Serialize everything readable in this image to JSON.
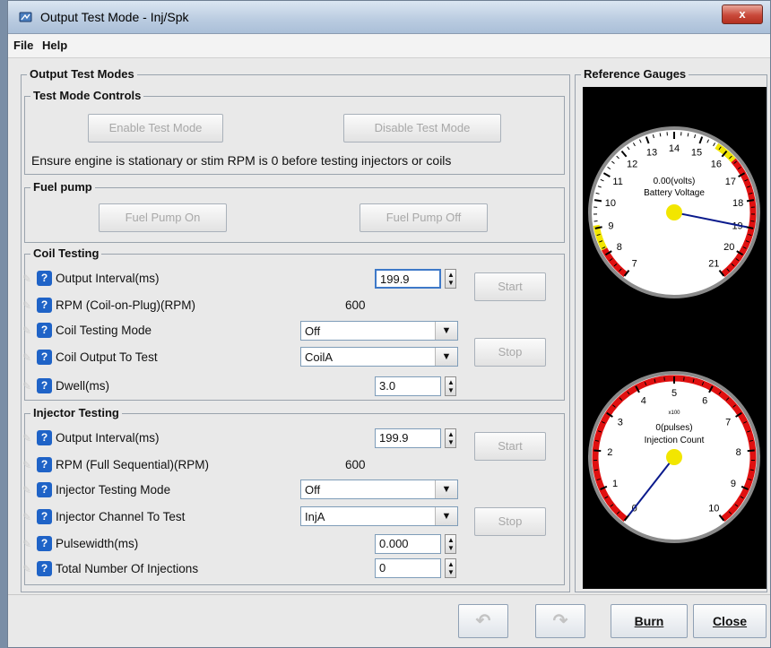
{
  "window": {
    "title": "Output Test Mode - Inj/Spk",
    "close_glyph": "x"
  },
  "menu": {
    "file": "File",
    "help": "Help"
  },
  "output_test_modes": {
    "label": "Output Test Modes",
    "test_mode_controls": {
      "label": "Test Mode Controls",
      "enable_button": "Enable Test Mode",
      "disable_button": "Disable Test Mode",
      "warning": "Ensure engine is stationary or stim RPM is 0 before testing injectors or coils"
    },
    "fuel_pump": {
      "label": "Fuel pump",
      "on_button": "Fuel Pump On",
      "off_button": "Fuel Pump Off"
    },
    "coil_testing": {
      "label": "Coil Testing",
      "output_interval": {
        "label": "Output Interval(ms)",
        "value": "199.9"
      },
      "rpm": {
        "label": "RPM (Coil-on-Plug)(RPM)",
        "value": "600"
      },
      "mode": {
        "label": "Coil Testing Mode",
        "value": "Off"
      },
      "output_to_test": {
        "label": "Coil Output To Test",
        "value": "CoilA"
      },
      "dwell": {
        "label": "Dwell(ms)",
        "value": "3.0"
      },
      "start_button": "Start",
      "stop_button": "Stop"
    },
    "injector_testing": {
      "label": "Injector Testing",
      "output_interval": {
        "label": "Output Interval(ms)",
        "value": "199.9"
      },
      "rpm": {
        "label": "RPM (Full Sequential)(RPM)",
        "value": "600"
      },
      "mode": {
        "label": "Injector Testing Mode",
        "value": "Off"
      },
      "channel": {
        "label": "Injector Channel To Test",
        "value": "InjA"
      },
      "pulsewidth": {
        "label": "Pulsewidth(ms)",
        "value": "0.000"
      },
      "total_injections": {
        "label": "Total Number Of Injections",
        "value": "0"
      },
      "start_button": "Start",
      "stop_button": "Stop"
    }
  },
  "reference_gauges": {
    "label": "Reference Gauges",
    "battery": {
      "reading": "0.00(volts)",
      "title": "Battery Voltage",
      "min": 7,
      "max": 21,
      "value": 19,
      "ticks": [
        "7",
        "8",
        "9",
        "10",
        "11",
        "12",
        "13",
        "14",
        "15",
        "16",
        "17",
        "18",
        "19",
        "20",
        "21"
      ],
      "color_needle": "#0a1a8c",
      "color_warn": "#f2e600",
      "color_danger": "#e01010"
    },
    "injection": {
      "reading": "0(pulses)",
      "multiplier": "x100",
      "title": "Injection Count",
      "min": 0,
      "max": 10,
      "value": 0,
      "ticks": [
        "0",
        "1",
        "2",
        "3",
        "4",
        "5",
        "6",
        "7",
        "8",
        "9",
        "10"
      ],
      "color_needle": "#0a1a8c",
      "color_danger": "#e01010"
    }
  },
  "footer": {
    "burn": "Burn",
    "close": "Close",
    "undo_icon": "undo-icon",
    "redo_icon": "redo-icon"
  }
}
